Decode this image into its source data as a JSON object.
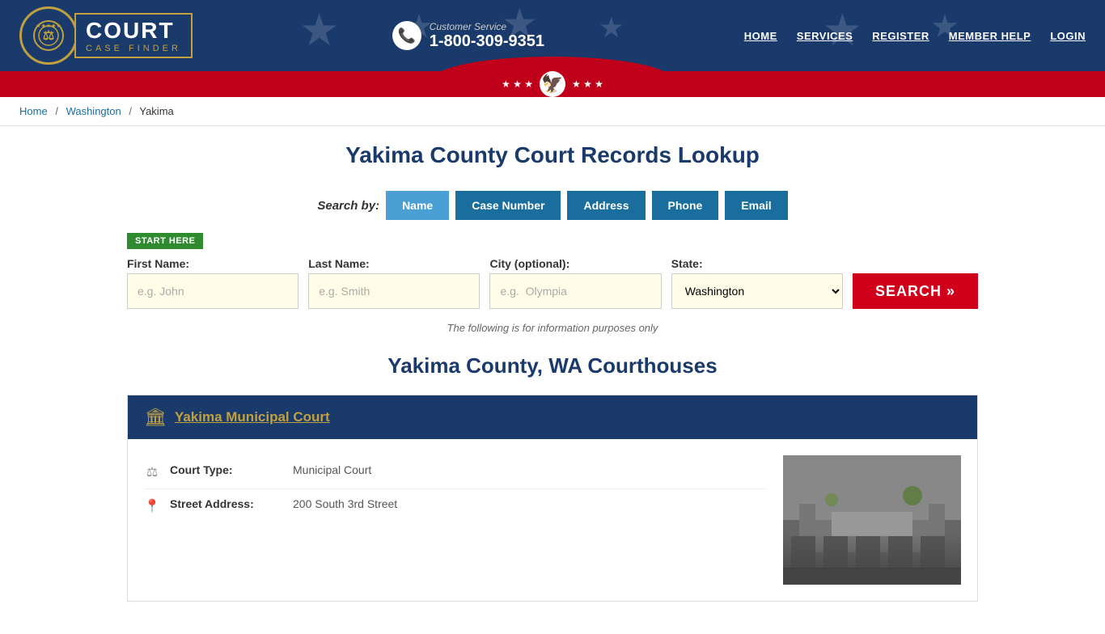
{
  "header": {
    "logo_court": "COURT",
    "logo_sub": "CASE FINDER",
    "cs_label": "Customer Service",
    "cs_phone": "1-800-309-9351",
    "nav": [
      "HOME",
      "SERVICES",
      "REGISTER",
      "MEMBER HELP",
      "LOGIN"
    ]
  },
  "breadcrumb": {
    "home": "Home",
    "state": "Washington",
    "county": "Yakima"
  },
  "page_title": "Yakima County Court Records Lookup",
  "search": {
    "by_label": "Search by:",
    "tabs": [
      "Name",
      "Case Number",
      "Address",
      "Phone",
      "Email"
    ],
    "active_tab": "Name",
    "start_here": "START HERE",
    "fields": {
      "first_name_label": "First Name:",
      "first_name_placeholder": "e.g. John",
      "last_name_label": "Last Name:",
      "last_name_placeholder": "e.g. Smith",
      "city_label": "City (optional):",
      "city_placeholder": "e.g.  Olympia",
      "state_label": "State:",
      "state_value": "Washington"
    },
    "search_button": "SEARCH »",
    "disclaimer": "The following is for information purposes only"
  },
  "courthouses_title": "Yakima County, WA Courthouses",
  "courthouses": [
    {
      "name": "Yakima Municipal Court",
      "details": [
        {
          "icon": "⚖",
          "label": "Court Type:",
          "value": "Municipal Court"
        },
        {
          "icon": "📍",
          "label": "Street Address:",
          "value": "200 South 3rd Street"
        }
      ]
    }
  ]
}
